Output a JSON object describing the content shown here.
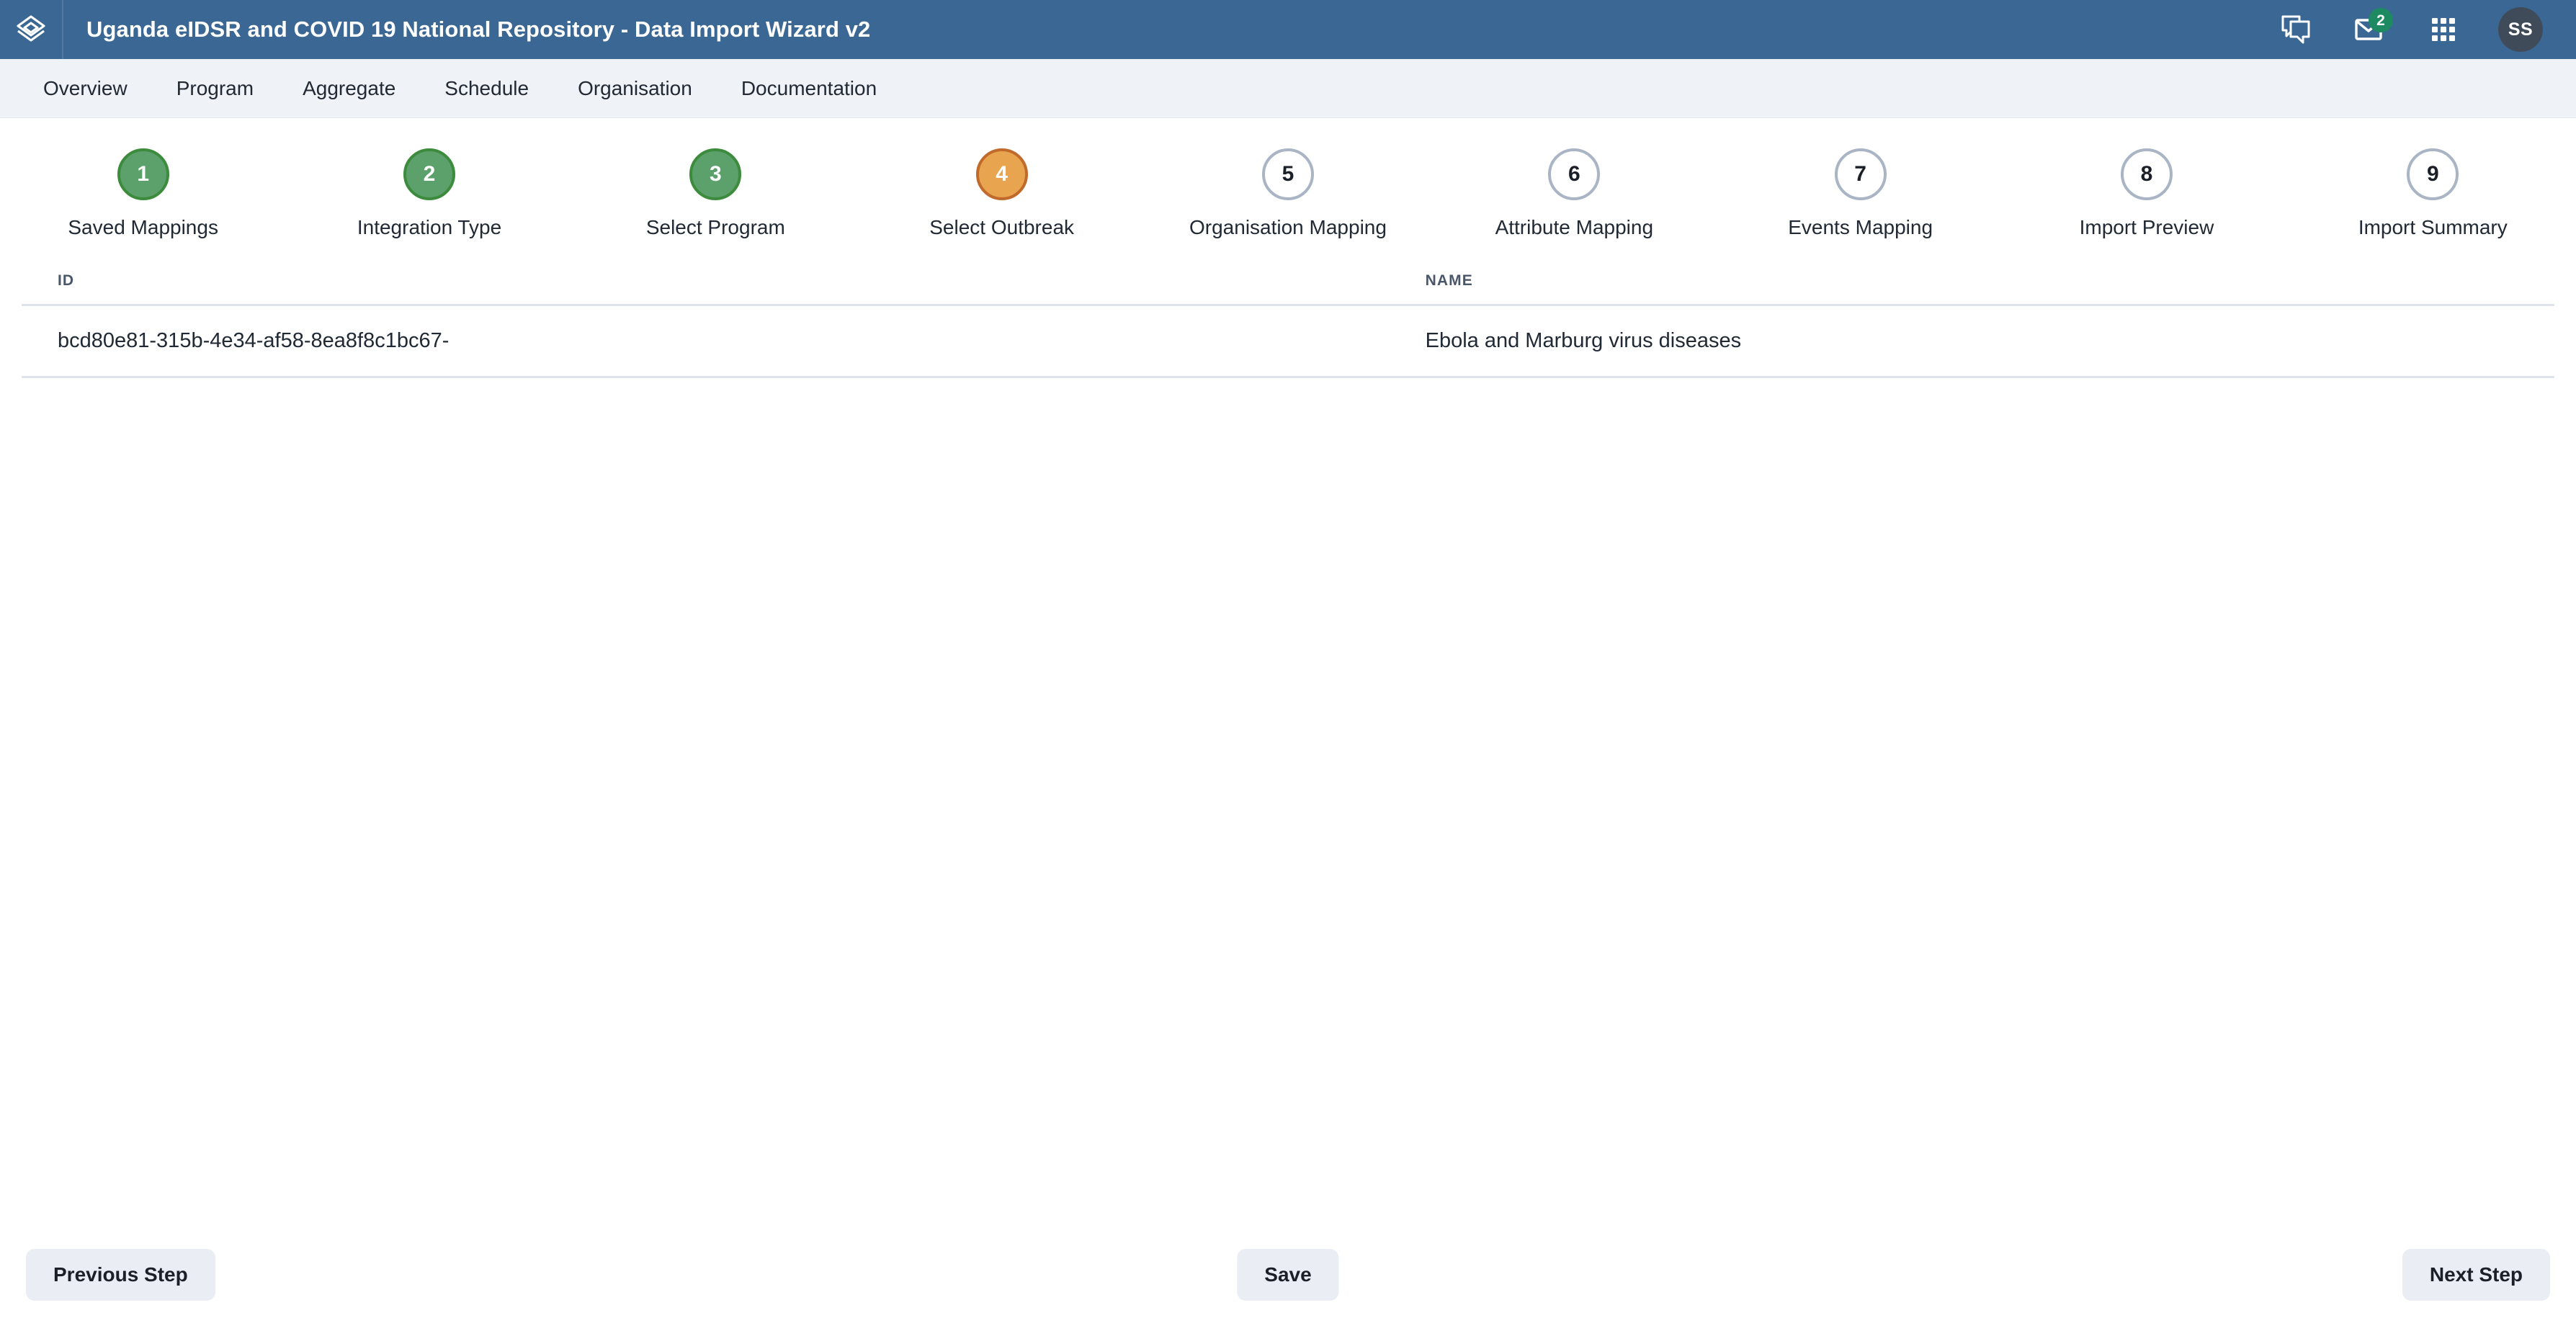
{
  "header": {
    "logo_icon": "dhis2-layers-logo-icon",
    "title": "Uganda eIDSR and COVID 19 National Repository - Data Import Wizard v2",
    "icons": [
      {
        "name": "messages-icon",
        "glyph": "chat-bubbles"
      },
      {
        "name": "mail-icon",
        "glyph": "envelope",
        "badge": "2"
      },
      {
        "name": "apps-menu-icon",
        "glyph": "grid-3x3"
      }
    ],
    "avatar_initials": "SS",
    "colors": {
      "header_bg": "#3a6793",
      "badge_bg": "#1d8a62",
      "avatar_bg": "#404b5a"
    }
  },
  "nav": {
    "items": [
      {
        "label": "Overview"
      },
      {
        "label": "Program"
      },
      {
        "label": "Aggregate"
      },
      {
        "label": "Schedule"
      },
      {
        "label": "Organisation"
      },
      {
        "label": "Documentation"
      }
    ]
  },
  "stepper": {
    "steps": [
      {
        "number": "1",
        "label": "Saved Mappings",
        "state": "done"
      },
      {
        "number": "2",
        "label": "Integration Type",
        "state": "done"
      },
      {
        "number": "3",
        "label": "Select Program",
        "state": "done"
      },
      {
        "number": "4",
        "label": "Select Outbreak",
        "state": "active"
      },
      {
        "number": "5",
        "label": "Organisation Mapping",
        "state": "todo"
      },
      {
        "number": "6",
        "label": "Attribute Mapping",
        "state": "todo"
      },
      {
        "number": "7",
        "label": "Events Mapping",
        "state": "todo"
      },
      {
        "number": "8",
        "label": "Import Preview",
        "state": "todo"
      },
      {
        "number": "9",
        "label": "Import Summary",
        "state": "todo"
      }
    ],
    "colors": {
      "done_fill": "#5ca06c",
      "done_border": "#3d8c3d",
      "active_fill": "#e8a44f",
      "active_border": "#c06a2b",
      "todo_border": "#a9b4c4"
    }
  },
  "table": {
    "columns": [
      {
        "key": "id",
        "header": "ID"
      },
      {
        "key": "name",
        "header": "NAME"
      }
    ],
    "rows": [
      {
        "id": "bcd80e81-315b-4e34-af58-8ea8f8c1bc67-",
        "name": "Ebola and Marburg virus diseases"
      }
    ]
  },
  "footer": {
    "previous_label": "Previous Step",
    "save_label": "Save",
    "next_label": "Next Step"
  }
}
